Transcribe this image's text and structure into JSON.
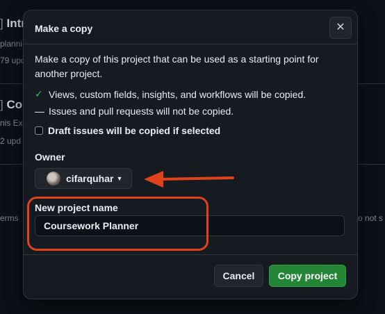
{
  "background": {
    "project1_title": "Intr",
    "project1_meta_a": "planni",
    "project1_meta_b": "79 upd",
    "project2_title": "Co",
    "project2_meta_a": "nis Ex",
    "project2_meta_b": "2 upd",
    "left_text": "erms",
    "right_text": "o not s"
  },
  "dialog": {
    "title": "Make a copy",
    "close_icon": "x-icon",
    "description": "Make a copy of this project that can be used as a starting point for another project.",
    "info_copied": "Views, custom fields, insights, and workflows will be copied.",
    "info_not_copied": "Issues and pull requests will not be copied.",
    "draft_checkbox_label": "Draft issues will be copied if selected",
    "draft_checkbox_checked": false,
    "owner_label": "Owner",
    "owner_value": "cifarquhar",
    "project_name_label": "New project name",
    "project_name_value": "Coursework Planner",
    "cancel_label": "Cancel",
    "copy_label": "Copy project"
  },
  "colors": {
    "accent_green": "#238636",
    "annotation": "#e0421a"
  }
}
